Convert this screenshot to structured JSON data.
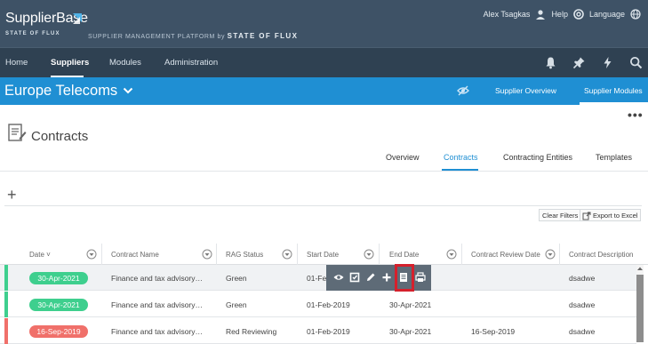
{
  "brand": {
    "name": "SupplierBase",
    "tagline": "STATE OF FLUX",
    "platform_text": "SUPPLIER MANAGEMENT PLATFORM",
    "platform_by": "by",
    "platform_company": "STATE OF FLUX"
  },
  "user_area": {
    "user_name": "Alex Tsagkas",
    "help_label": "Help",
    "language_label": "Language"
  },
  "nav": {
    "items": [
      {
        "label": "Home"
      },
      {
        "label": "Suppliers",
        "active": true
      },
      {
        "label": "Modules"
      },
      {
        "label": "Administration"
      }
    ],
    "right_icons": [
      "bell-icon",
      "pin-icon",
      "lightning-icon",
      "search-icon"
    ]
  },
  "context": {
    "supplier_name": "Europe Telecoms",
    "links": [
      {
        "label": "Supplier Overview"
      },
      {
        "label": "Supplier Modules",
        "active": true
      }
    ]
  },
  "page": {
    "title": "Contracts",
    "more_label": "•••",
    "add_label": "+",
    "tabs": [
      {
        "label": "Overview"
      },
      {
        "label": "Contracts",
        "active": true
      },
      {
        "label": "Contracting Entities"
      },
      {
        "label": "Templates"
      }
    ],
    "clear_filters_label": "Clear Filters",
    "export_label": "Export to Excel"
  },
  "table": {
    "columns": [
      {
        "label": "Date"
      },
      {
        "label": "Contract Name"
      },
      {
        "label": "RAG Status"
      },
      {
        "label": "Start Date"
      },
      {
        "label": "End Date"
      },
      {
        "label": "Contract Review Date"
      },
      {
        "label": "Contract Description"
      }
    ],
    "rows": [
      {
        "date": "30-Apr-2021",
        "date_color": "#3ecf8e",
        "flag_color": "#3ecf8e",
        "name": "Finance and tax advisory…",
        "rag": "Green",
        "start": "01-Fe",
        "end": "",
        "review": "",
        "description": "dsadwe"
      },
      {
        "date": "30-Apr-2021",
        "date_color": "#3ecf8e",
        "flag_color": "#3ecf8e",
        "name": "Finance and tax advisory…",
        "rag": "Green",
        "start": "01-Feb-2019",
        "end": "30-Apr-2021",
        "review": "",
        "description": "dsadwe"
      },
      {
        "date": "16-Sep-2019",
        "date_color": "#f0706a",
        "flag_color": "#f0706a",
        "name": "Finance and tax advisory…",
        "rag": "Red Reviewing",
        "start": "01-Feb-2019",
        "end": "30-Apr-2021",
        "review": "16-Sep-2019",
        "description": "dsadwe"
      }
    ]
  },
  "row_actions": [
    "eye-icon",
    "checkbox-icon",
    "pencil-icon",
    "plus-icon",
    "document-icon",
    "print-icon"
  ],
  "colors": {
    "header_bg": "#3e5266",
    "nav_bg": "#2f4152",
    "accent_blue": "#1f8fd3",
    "green_badge": "#3ecf8e",
    "red_badge": "#f0706a",
    "highlight_red": "#d5202c"
  }
}
